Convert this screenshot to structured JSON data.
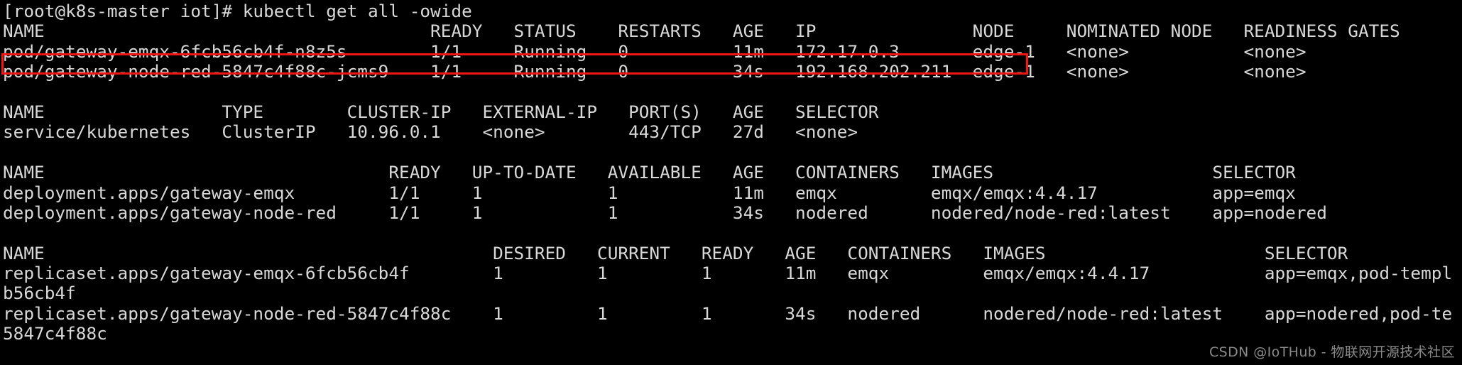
{
  "terminal": {
    "prompt": "[root@k8s-master iot]# ",
    "command": "kubectl get all -owide",
    "colors": {
      "background": "#000000",
      "foreground": "#d8d8d8",
      "highlight": "#f31414",
      "watermark": "#8a8a8a"
    },
    "lines": [
      "[root@k8s-master iot]# kubectl get all -owide",
      "NAME                                     READY   STATUS    RESTARTS   AGE   IP               NODE     NOMINATED NODE   READINESS GATES",
      "pod/gateway-emqx-6fcb56cb4f-n8z5s        1/1     Running   0          11m   172.17.0.3       edge-1   <none>           <none>",
      "pod/gateway-node-red-5847c4f88c-jcms9    1/1     Running   0          34s   192.168.202.211  edge-1   <none>           <none>",
      "",
      "NAME                 TYPE        CLUSTER-IP   EXTERNAL-IP   PORT(S)   AGE   SELECTOR",
      "service/kubernetes   ClusterIP   10.96.0.1    <none>        443/TCP   27d   <none>",
      "",
      "NAME                                 READY   UP-TO-DATE   AVAILABLE   AGE   CONTAINERS   IMAGES                     SELECTOR",
      "deployment.apps/gateway-emqx         1/1     1            1           11m   emqx         emqx/emqx:4.4.17           app=emqx",
      "deployment.apps/gateway-node-red     1/1     1            1           34s   nodered      nodered/node-red:latest    app=nodered",
      "",
      "NAME                                           DESIRED   CURRENT   READY   AGE   CONTAINERS   IMAGES                     SELECTOR",
      "replicaset.apps/gateway-emqx-6fcb56cb4f        1         1         1       11m   emqx         emqx/emqx:4.4.17           app=emqx,pod-templ",
      "b56cb4f",
      "replicaset.apps/gateway-node-red-5847c4f88c    1         1         1       34s   nodered      nodered/node-red:latest    app=nodered,pod-te",
      "5847c4f88c"
    ],
    "pods": {
      "headers": [
        "NAME",
        "READY",
        "STATUS",
        "RESTARTS",
        "AGE",
        "IP",
        "NODE",
        "NOMINATED NODE",
        "READINESS GATES"
      ],
      "rows": [
        [
          "pod/gateway-emqx-6fcb56cb4f-n8z5s",
          "1/1",
          "Running",
          "0",
          "11m",
          "172.17.0.3",
          "edge-1",
          "<none>",
          "<none>"
        ],
        [
          "pod/gateway-node-red-5847c4f88c-jcms9",
          "1/1",
          "Running",
          "0",
          "34s",
          "192.168.202.211",
          "edge-1",
          "<none>",
          "<none>"
        ]
      ],
      "highlighted_row_index": 1
    },
    "services": {
      "headers": [
        "NAME",
        "TYPE",
        "CLUSTER-IP",
        "EXTERNAL-IP",
        "PORT(S)",
        "AGE",
        "SELECTOR"
      ],
      "rows": [
        [
          "service/kubernetes",
          "ClusterIP",
          "10.96.0.1",
          "<none>",
          "443/TCP",
          "27d",
          "<none>"
        ]
      ]
    },
    "deployments": {
      "headers": [
        "NAME",
        "READY",
        "UP-TO-DATE",
        "AVAILABLE",
        "AGE",
        "CONTAINERS",
        "IMAGES",
        "SELECTOR"
      ],
      "rows": [
        [
          "deployment.apps/gateway-emqx",
          "1/1",
          "1",
          "1",
          "11m",
          "emqx",
          "emqx/emqx:4.4.17",
          "app=emqx"
        ],
        [
          "deployment.apps/gateway-node-red",
          "1/1",
          "1",
          "1",
          "34s",
          "nodered",
          "nodered/node-red:latest",
          "app=nodered"
        ]
      ]
    },
    "replicasets": {
      "headers": [
        "NAME",
        "DESIRED",
        "CURRENT",
        "READY",
        "AGE",
        "CONTAINERS",
        "IMAGES",
        "SELECTOR"
      ],
      "rows": [
        [
          "replicaset.apps/gateway-emqx-6fcb56cb4f",
          "1",
          "1",
          "1",
          "11m",
          "emqx",
          "emqx/emqx:4.4.17",
          "app=emqx,pod-templ"
        ],
        [
          "replicaset.apps/gateway-node-red-5847c4f88c",
          "1",
          "1",
          "1",
          "34s",
          "nodered",
          "nodered/node-red:latest",
          "app=nodered,pod-te"
        ]
      ],
      "wrapped_fragments": [
        "b56cb4f",
        "5847c4f88c"
      ]
    }
  },
  "watermark": "CSDN @IoTHub - 物联网开源技术社区"
}
